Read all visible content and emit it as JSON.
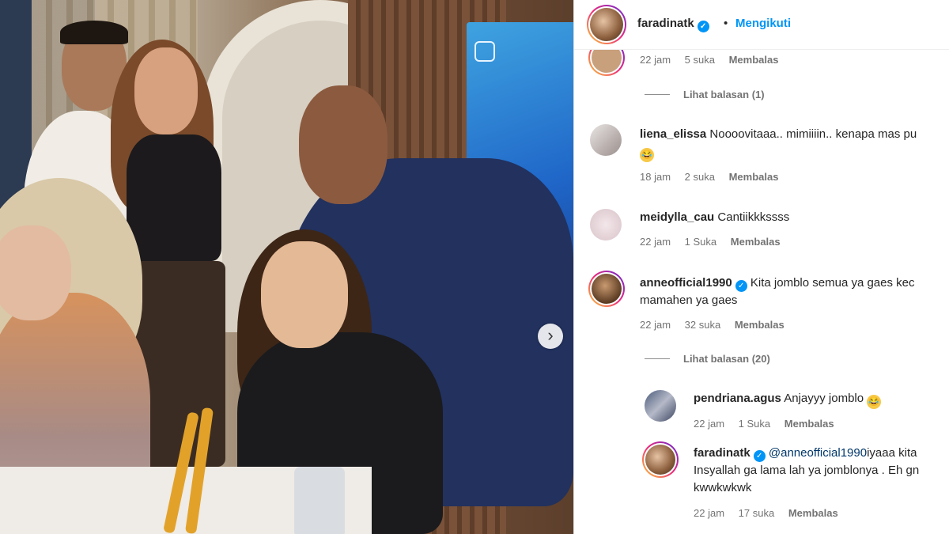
{
  "post": {
    "header": {
      "username": "faradinatk",
      "verified_icon": "verified-badge-icon",
      "separator": "•",
      "follow_label": "Mengikuti"
    },
    "carousel_next_icon": "chevron-right-icon"
  },
  "comments": [
    {
      "time": "22 jam",
      "likes": "5 suka",
      "reply_label": "Membalas",
      "view_replies": "Lihat balasan (1)"
    },
    {
      "username": "liena_elissa",
      "text": "Noooovitaaa.. mimiiiin.. kenapa mas pu",
      "emoji": "😂",
      "time": "18 jam",
      "likes": "2 suka",
      "reply_label": "Membalas"
    },
    {
      "username": "meidylla_cau",
      "text": "Cantiikkkssss",
      "time": "22 jam",
      "likes": "1 Suka",
      "reply_label": "Membalas"
    },
    {
      "username": "anneofficial1990",
      "text_line1": "Kita jomblo semua ya gaes kec",
      "text_line2": "mamahen ya gaes",
      "time": "22 jam",
      "likes": "32 suka",
      "reply_label": "Membalas",
      "view_replies": "Lihat balasan (20)",
      "replies": [
        {
          "username": "pendriana.agus",
          "text": "Anjayyy jomblo",
          "emoji": "😂",
          "time": "22 jam",
          "likes": "1 Suka",
          "reply_label": "Membalas"
        },
        {
          "username": "faradinatk",
          "mention": "@anneofficial1990",
          "text_line1": "iyaaa kita",
          "text_line2": "Insyallah ga lama lah ya jomblonya . Eh gn",
          "text_line3": "kwwkwkwk",
          "time": "22 jam",
          "likes": "17 suka",
          "reply_label": "Membalas"
        }
      ]
    }
  ]
}
